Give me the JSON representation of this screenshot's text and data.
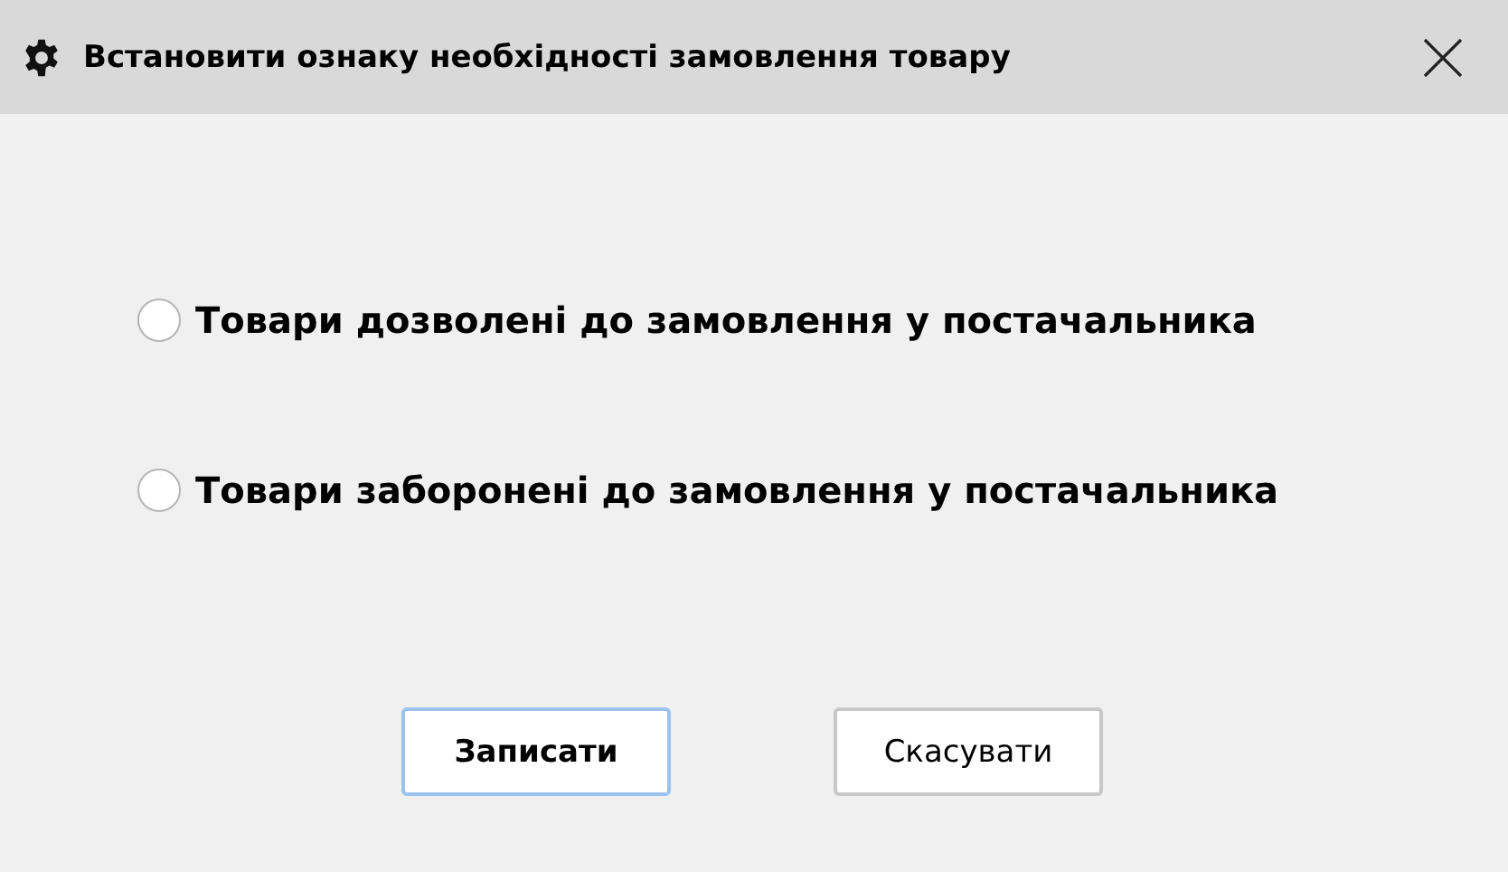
{
  "window": {
    "title": "Встановити ознаку необхідності замовлення товару"
  },
  "options": [
    {
      "label": "Товари дозволені до замовлення у постачальника",
      "selected": false
    },
    {
      "label": "Товари заборонені до замовлення у постачальника",
      "selected": false
    }
  ],
  "buttons": [
    {
      "label": "Записати",
      "kind": "default"
    },
    {
      "label": "Скасувати",
      "kind": "normal"
    }
  ]
}
